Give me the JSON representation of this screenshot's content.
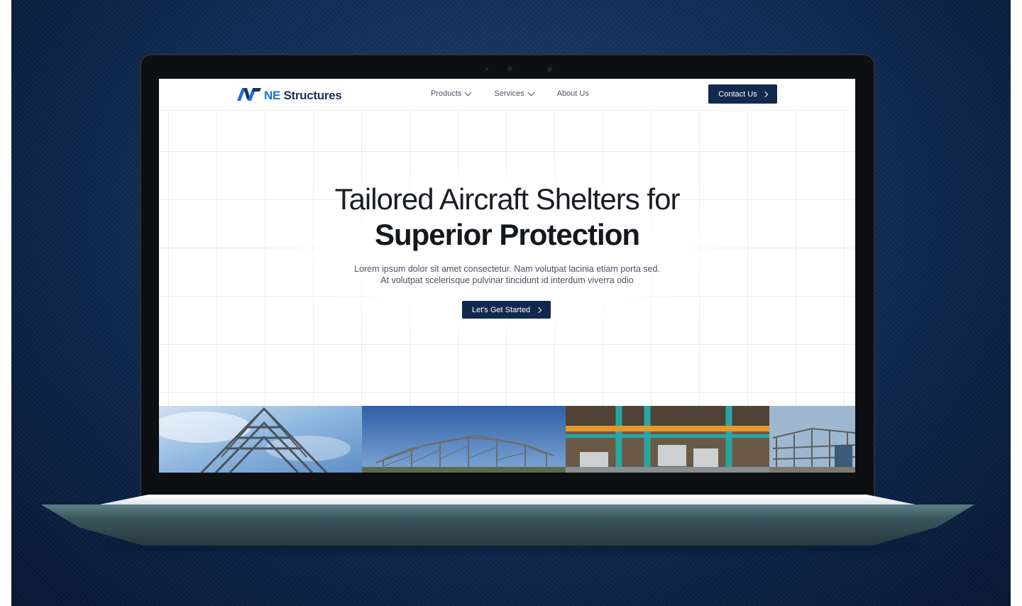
{
  "site": {
    "logo": {
      "prefix": "NE",
      "name": "Structures"
    },
    "nav": {
      "items": [
        {
          "label": "Products",
          "has_dropdown": true
        },
        {
          "label": "Services",
          "has_dropdown": true
        },
        {
          "label": "About Us",
          "has_dropdown": false
        }
      ],
      "contact_label": "Contact Us"
    },
    "hero": {
      "headline_line1": "Tailored Aircraft Shelters for",
      "headline_line2": "Superior Protection",
      "lede_line1": "Lorem ipsum dolor sit amet consectetur. Nam volutpat lacinia etiam porta sed.",
      "lede_line2": "At volutpat scelerisque pulvinar tincidunt id interdum viverra odio",
      "cta_label": "Let's Get Started"
    },
    "gallery": [
      {
        "icon": "steel-frame-sky-photo"
      },
      {
        "icon": "structure-frame-photo"
      },
      {
        "icon": "warehouse-interior-photo"
      },
      {
        "icon": "construction-site-photo"
      }
    ]
  },
  "colors": {
    "brand_navy": "#11294d",
    "brand_blue": "#1c6fd8",
    "backdrop": "#0b2143"
  }
}
